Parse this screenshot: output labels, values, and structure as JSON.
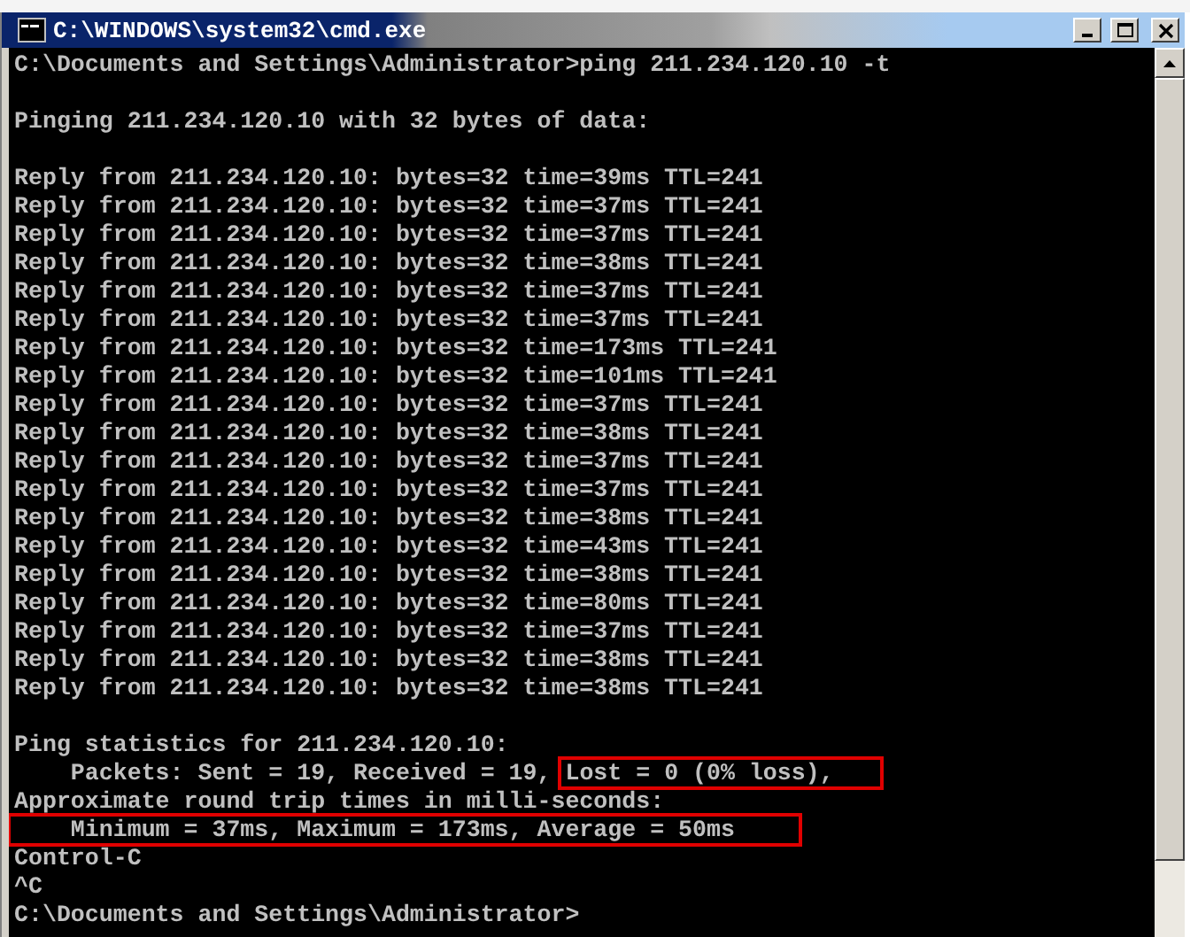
{
  "window": {
    "title": "C:\\WINDOWS\\system32\\cmd.exe"
  },
  "console": {
    "lines": [
      {
        "kind": "text",
        "text": "C:\\Documents and Settings\\Administrator>ping 211.234.120.10 -t"
      },
      {
        "kind": "blank"
      },
      {
        "kind": "text",
        "text": "Pinging 211.234.120.10 with 32 bytes of data:"
      },
      {
        "kind": "blank"
      },
      {
        "kind": "text",
        "text": "Reply from 211.234.120.10: bytes=32 time=39ms TTL=241"
      },
      {
        "kind": "text",
        "text": "Reply from 211.234.120.10: bytes=32 time=37ms TTL=241"
      },
      {
        "kind": "text",
        "text": "Reply from 211.234.120.10: bytes=32 time=37ms TTL=241"
      },
      {
        "kind": "text",
        "text": "Reply from 211.234.120.10: bytes=32 time=38ms TTL=241"
      },
      {
        "kind": "text",
        "text": "Reply from 211.234.120.10: bytes=32 time=37ms TTL=241"
      },
      {
        "kind": "text",
        "text": "Reply from 211.234.120.10: bytes=32 time=37ms TTL=241"
      },
      {
        "kind": "text",
        "text": "Reply from 211.234.120.10: bytes=32 time=173ms TTL=241"
      },
      {
        "kind": "text",
        "text": "Reply from 211.234.120.10: bytes=32 time=101ms TTL=241"
      },
      {
        "kind": "text",
        "text": "Reply from 211.234.120.10: bytes=32 time=37ms TTL=241"
      },
      {
        "kind": "text",
        "text": "Reply from 211.234.120.10: bytes=32 time=38ms TTL=241"
      },
      {
        "kind": "text",
        "text": "Reply from 211.234.120.10: bytes=32 time=37ms TTL=241"
      },
      {
        "kind": "text",
        "text": "Reply from 211.234.120.10: bytes=32 time=37ms TTL=241"
      },
      {
        "kind": "text",
        "text": "Reply from 211.234.120.10: bytes=32 time=38ms TTL=241"
      },
      {
        "kind": "text",
        "text": "Reply from 211.234.120.10: bytes=32 time=43ms TTL=241"
      },
      {
        "kind": "text",
        "text": "Reply from 211.234.120.10: bytes=32 time=38ms TTL=241"
      },
      {
        "kind": "text",
        "text": "Reply from 211.234.120.10: bytes=32 time=80ms TTL=241"
      },
      {
        "kind": "text",
        "text": "Reply from 211.234.120.10: bytes=32 time=37ms TTL=241"
      },
      {
        "kind": "text",
        "text": "Reply from 211.234.120.10: bytes=32 time=38ms TTL=241"
      },
      {
        "kind": "text",
        "text": "Reply from 211.234.120.10: bytes=32 time=38ms TTL=241"
      },
      {
        "kind": "blank"
      },
      {
        "kind": "text",
        "text": "Ping statistics for 211.234.120.10:"
      },
      {
        "kind": "text",
        "text": "    Packets: Sent = 19, Received = 19,",
        "boxed": "Lost = 0 (0% loss),"
      },
      {
        "kind": "text",
        "text": "Approximate round trip times in milli-seconds:"
      },
      {
        "kind": "text",
        "boxed": "    Minimum = 37ms, Maximum = 173ms, Average = 50ms"
      },
      {
        "kind": "text",
        "text": "Control-C"
      },
      {
        "kind": "text",
        "text": "^C"
      },
      {
        "kind": "text",
        "text": "C:\\Documents and Settings\\Administrator>"
      }
    ]
  }
}
